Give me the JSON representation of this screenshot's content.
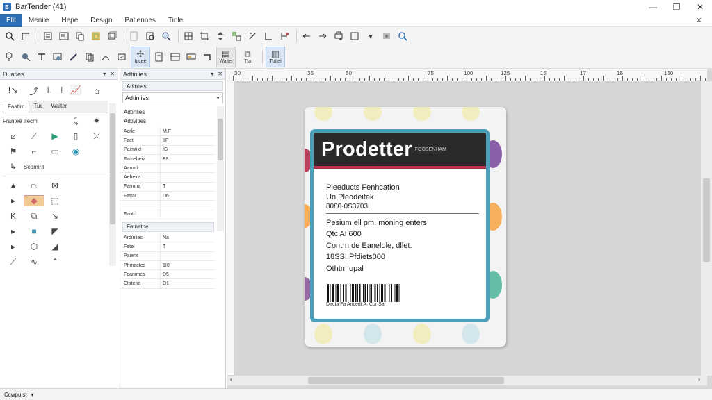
{
  "app": {
    "title": "BarTender (41)"
  },
  "menu": {
    "items": [
      "Elit",
      "Menile",
      "Hepe",
      "Design",
      "Patiennes",
      "Tinle"
    ],
    "active_index": 0
  },
  "toolbar2": {
    "labels": {
      "g1": "Ipcee",
      "g2": "Waitei",
      "g3": "Tta",
      "g4": "Tuttei"
    }
  },
  "toolbox": {
    "title": "Duaties",
    "tabs": [
      "Faatim",
      "Tuc",
      "Walter"
    ],
    "rows": [
      "Frantee Irecm",
      "Seamirit"
    ]
  },
  "properties": {
    "title": "Adtinlies",
    "subtitle": "Adinties",
    "dropdown": "Adtinlies",
    "section_labels": [
      "Adtinlies",
      "Adtivities"
    ],
    "rows_a": [
      {
        "k": "Acrle",
        "v": "M.F"
      },
      {
        "k": "Fact",
        "v": "IIP"
      },
      {
        "k": "Paimtiid",
        "v": "IG"
      },
      {
        "k": "Fameheiz",
        "v": "B9"
      },
      {
        "k": "Aarmd",
        "v": ""
      },
      {
        "k": "Aeheira",
        "v": ""
      },
      {
        "k": "Farmna",
        "v": "T"
      },
      {
        "k": "Fattar",
        "v": "D6"
      },
      {
        "k": "",
        "v": ""
      },
      {
        "k": "Faotd",
        "v": ""
      }
    ],
    "section2": "Fatnethe",
    "rows_b": [
      {
        "k": "Ardinlies",
        "v": "Na"
      },
      {
        "k": "Fetel",
        "v": "T"
      },
      {
        "k": "Paiens",
        "v": ""
      },
      {
        "k": "Phmactes",
        "v": "1I0"
      },
      {
        "k": "Fpanimes",
        "v": "D5"
      },
      {
        "k": "Clatena",
        "v": "D1"
      }
    ]
  },
  "ruler": {
    "numbers": [
      "30",
      "35",
      "50",
      "75",
      "100",
      "125",
      "15",
      "17",
      "18",
      "150"
    ]
  },
  "label": {
    "brand": "Prodetter",
    "brand_sub": "FOOSENHAM",
    "line1": "Pleeducts Fenhcation",
    "line2": "Un Pleodeitek",
    "line3": "8080-0S3703",
    "line4": "Pesium ell pm. moning enters.",
    "line5": "Qtc Al 600",
    "line6": "Contrn de Eanelole, dllet.",
    "line7": "18SSI Pfdiets000",
    "line8": "Othtn Iopal",
    "barcode_text": "Dacta Fa Ancedt A. Cur Saf",
    "colors": {
      "frame": "#4aa0ba",
      "header": "#2a2a2c",
      "stripe": "#b3304b"
    }
  },
  "status": {
    "text": "Ccwpulst"
  },
  "icons": [
    "select-icon",
    "zoom-icon",
    "text-icon",
    "barcode-icon",
    "shape-icon",
    "line-icon",
    "print-icon"
  ]
}
